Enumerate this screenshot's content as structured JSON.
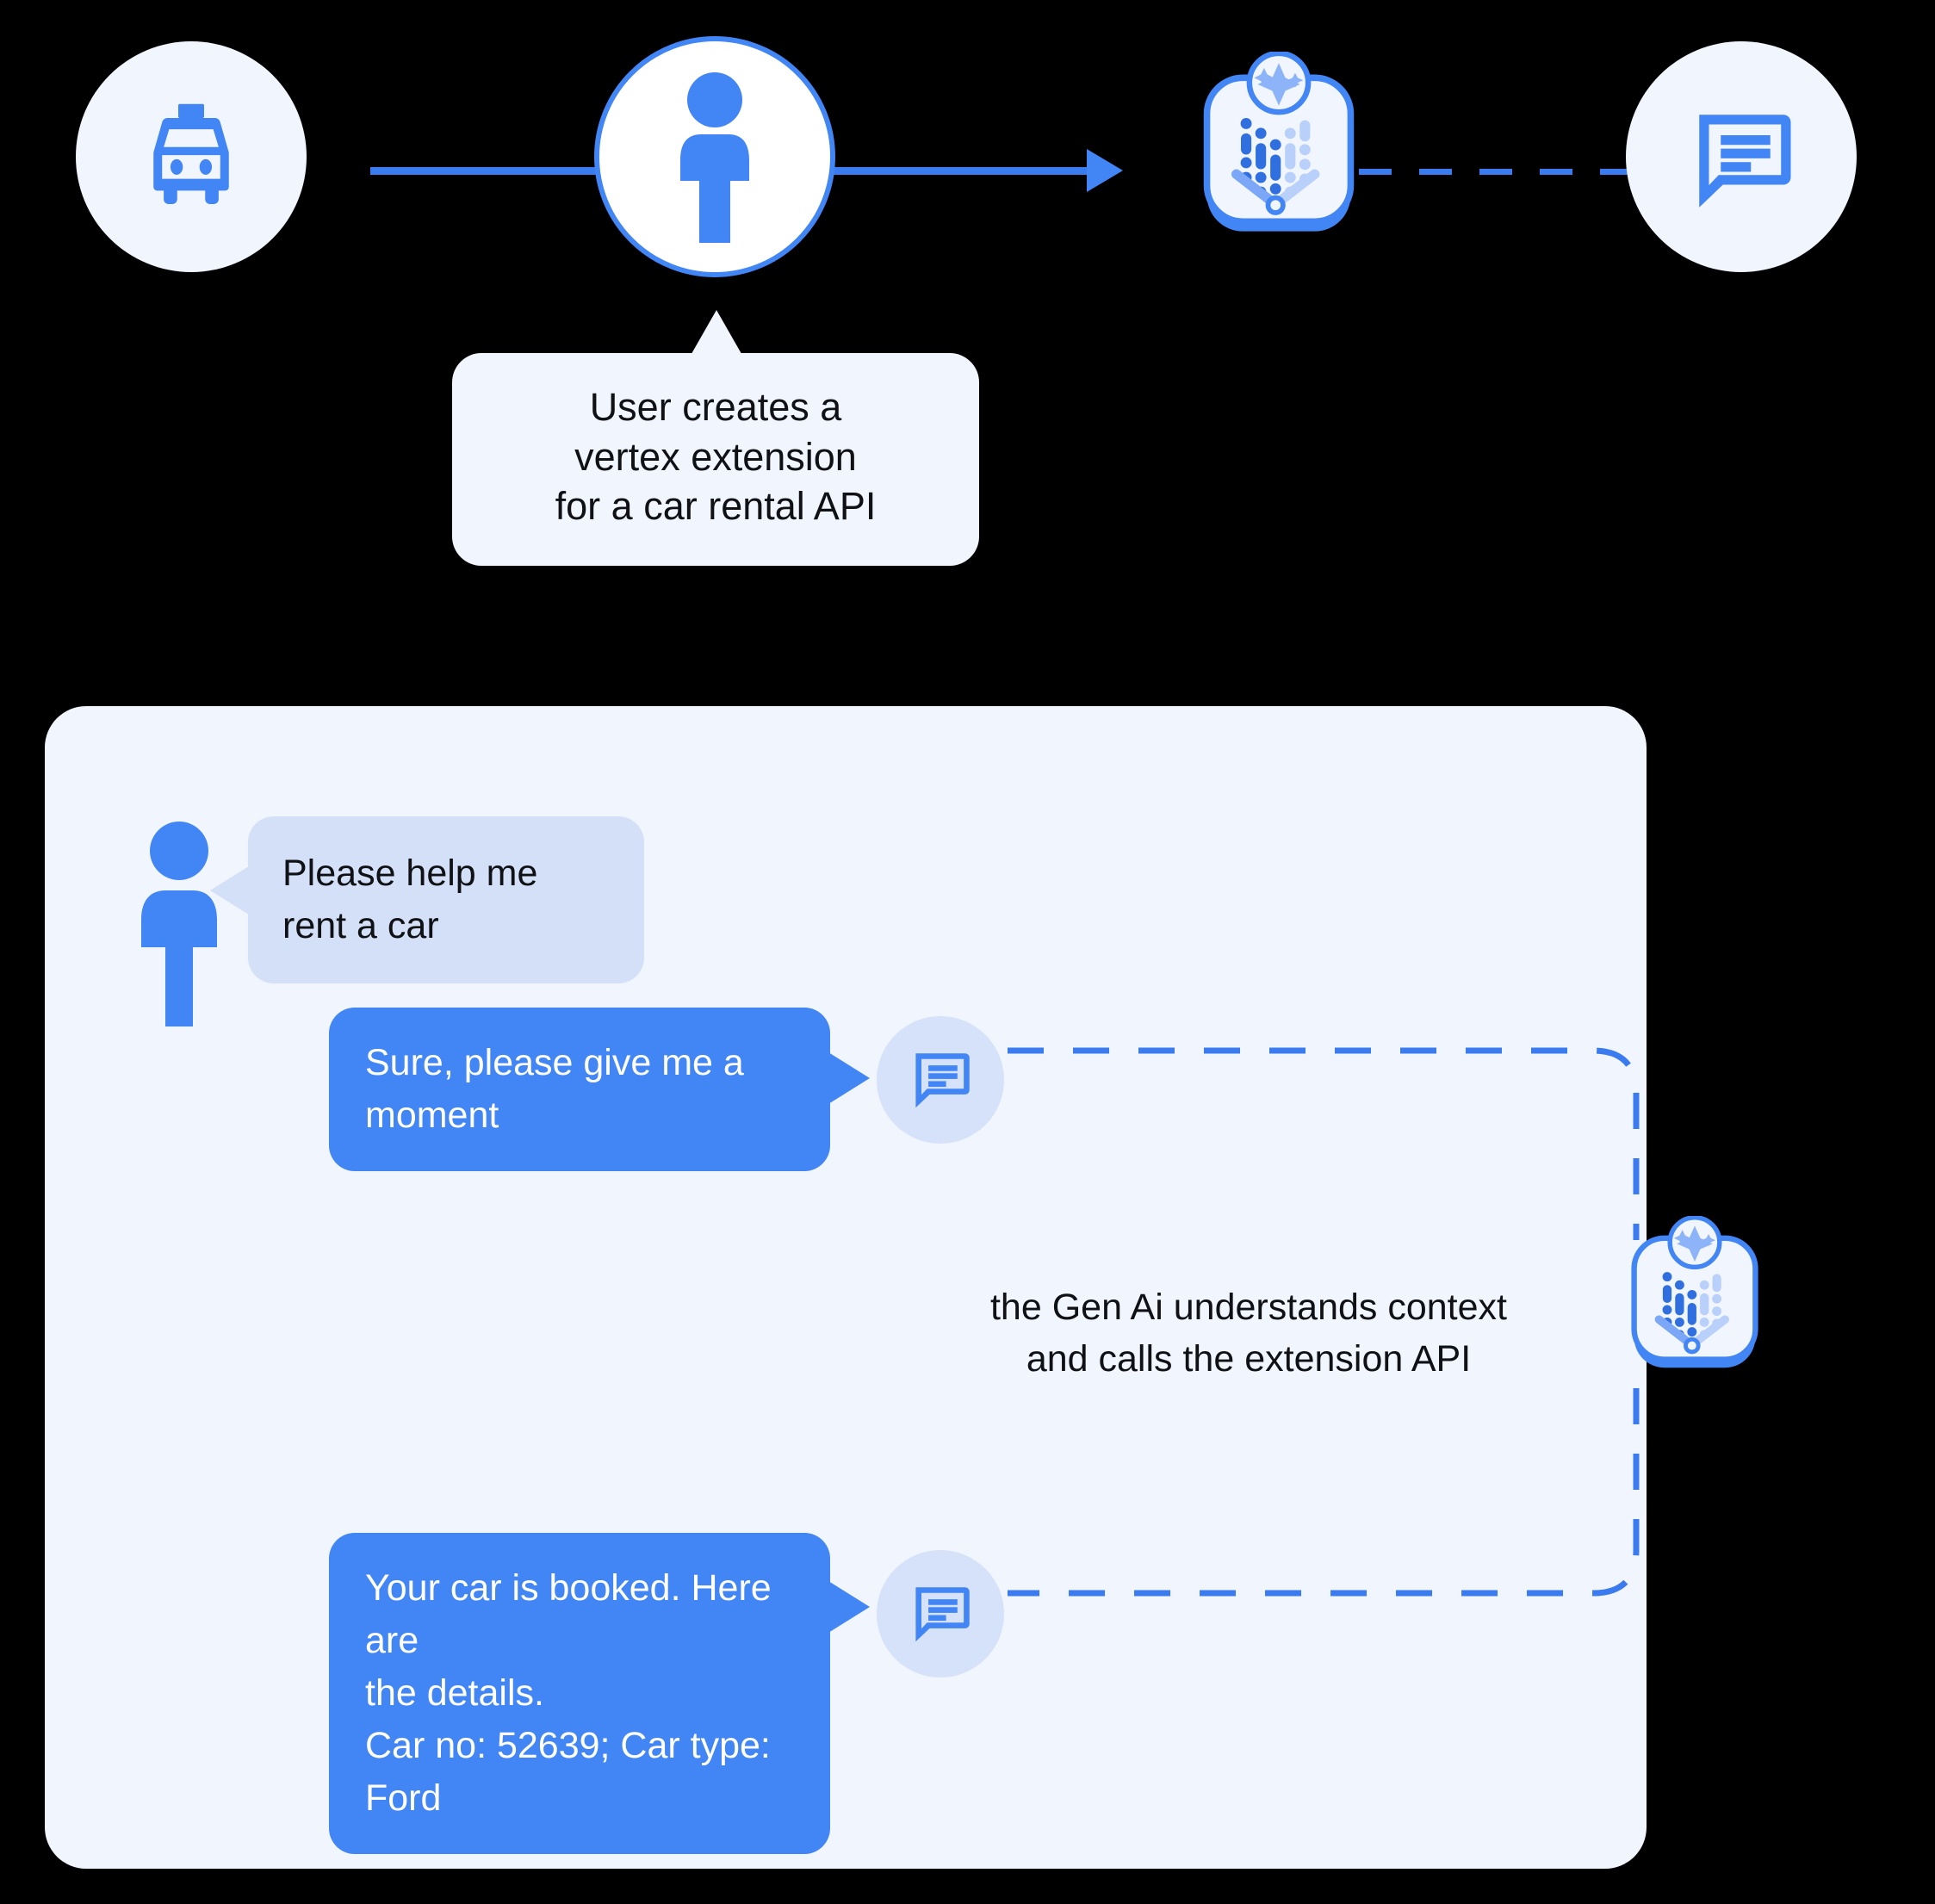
{
  "colors": {
    "background": "#000000",
    "panel_bg": "#f1f5fe",
    "accent_blue": "#4285f4",
    "line_blue": "#3b7bf0",
    "user_bubble": "#d3e0f8",
    "avatar_circle": "#d6e2f9",
    "text_dark": "#101114",
    "text_light": "#ffffff"
  },
  "top_flow": {
    "nodes": [
      {
        "id": "taxi",
        "icon": "taxi-icon",
        "label": "taxi"
      },
      {
        "id": "user",
        "icon": "person-icon",
        "label": "user"
      },
      {
        "id": "vertex",
        "icon": "vertex-extension-icon",
        "label": "vertex extension"
      },
      {
        "id": "chat",
        "icon": "chat-bubble-icon",
        "label": "chat"
      }
    ],
    "connector_solid": "arrow",
    "connector_dashed": "dashed"
  },
  "callout": {
    "line1": "User creates a",
    "line2": "vertex extension",
    "line3": "for a car rental API"
  },
  "chat": {
    "messages": [
      {
        "id": "msg-user-1",
        "sender": "user",
        "text": "Please help me rent a car"
      },
      {
        "id": "msg-bot-1",
        "sender": "bot",
        "text": "Sure, please give me a moment"
      },
      {
        "id": "msg-bot-2",
        "sender": "bot",
        "line1": "Your car is booked. Here are",
        "line2": "the details.",
        "line3": "Car no: 52639; Car type: Ford"
      }
    ],
    "context_note": {
      "line1": "the Gen Ai understands context",
      "line2": "and calls the extension API"
    },
    "avatars": {
      "user": "person-icon",
      "bot": "chat-bubble-icon",
      "extension": "vertex-extension-icon"
    }
  }
}
